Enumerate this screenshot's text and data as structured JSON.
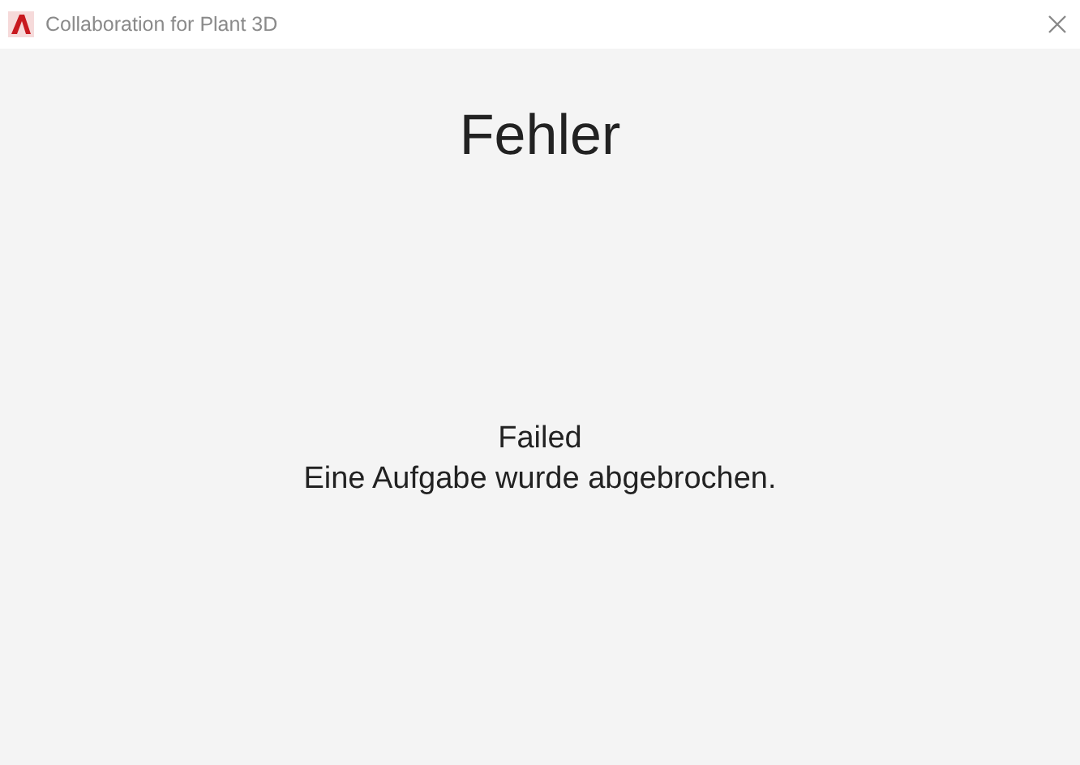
{
  "window": {
    "title": "Collaboration for Plant 3D"
  },
  "heading": "Fehler",
  "message": {
    "status": "Failed",
    "detail": "Eine Aufgabe wurde abgebrochen."
  }
}
